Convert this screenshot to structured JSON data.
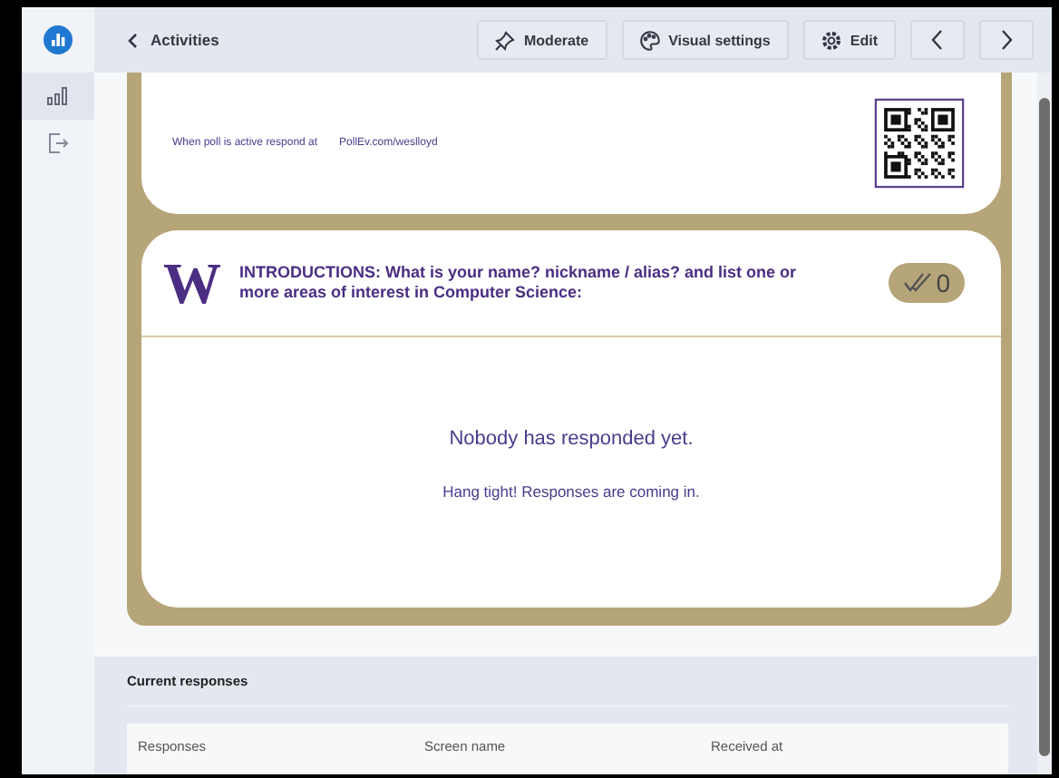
{
  "sidebar": {
    "items": [
      {
        "kind": "chart",
        "selected": true
      },
      {
        "kind": "exit",
        "selected": false
      }
    ]
  },
  "toolbar": {
    "back_link": "Activities",
    "buttons": [
      {
        "kind": "pin",
        "label": "Moderate"
      },
      {
        "kind": "palette",
        "label": "Visual settings"
      },
      {
        "kind": "gear",
        "label": "Edit"
      }
    ]
  },
  "poll": {
    "respond_text": "When poll is active respond at",
    "url": "PollEv.com/weslloyd",
    "logo": "W",
    "question": "INTRODUCTIONS: What is your name? nickname / alias? and list one or more areas of interest in Computer Science:",
    "response_count": "0",
    "empty_title": "Nobody has responded yet.",
    "empty_subtitle": "Hang tight! Responses are coming in."
  },
  "current_responses": {
    "title": "Current responses",
    "columns": [
      "Responses",
      "Screen name",
      "Received at"
    ]
  }
}
